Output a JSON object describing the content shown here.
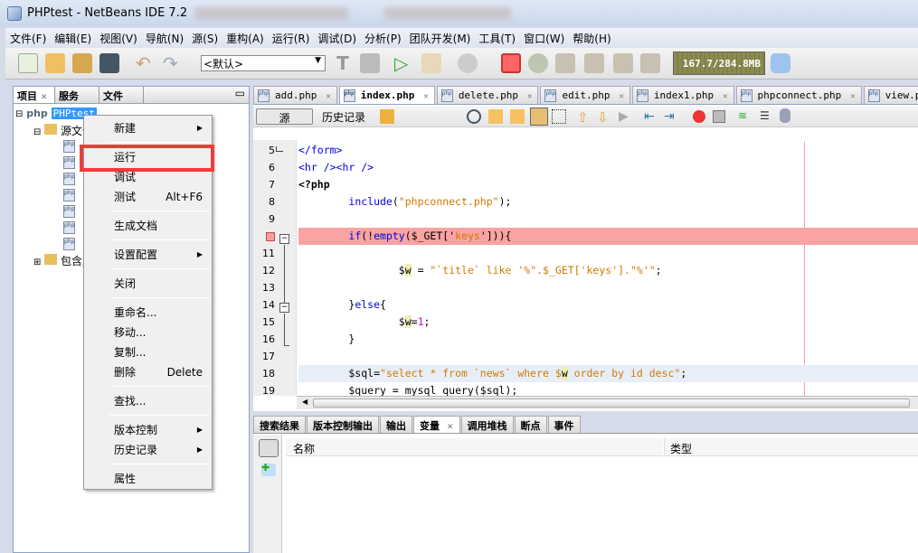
{
  "window": {
    "title": "PHPtest - NetBeans IDE 7.2"
  },
  "menu": [
    "文件(F)",
    "编辑(E)",
    "视图(V)",
    "导航(N)",
    "源(S)",
    "重构(A)",
    "运行(R)",
    "调试(D)",
    "分析(P)",
    "团队开发(M)",
    "工具(T)",
    "窗口(W)",
    "帮助(H)"
  ],
  "toolbar": {
    "config": "<默认>",
    "memory": "167.7/284.8MB"
  },
  "left_panel": {
    "tabs": [
      "项目",
      "服务",
      "文件"
    ],
    "project": "PHPtest",
    "project_icon": "php",
    "source_folder": "源文件",
    "include_folder": "包含路径",
    "file_count_icons": 7
  },
  "editor": {
    "tabs": [
      "add.php",
      "index.php",
      "delete.php",
      "edit.php",
      "index1.php",
      "phpconnect.php",
      "view.php"
    ],
    "active_tab": "index.php",
    "source_button": "源",
    "history_button": "历史记录",
    "lines": [
      {
        "n": "5",
        "seg": [
          [
            "</form>",
            "tag"
          ]
        ]
      },
      {
        "n": "6",
        "seg": [
          [
            "<hr /><hr />",
            "tag"
          ]
        ]
      },
      {
        "n": "7",
        "seg": [
          [
            "<?php",
            "php"
          ]
        ]
      },
      {
        "n": "8",
        "seg": [
          [
            "        ",
            ""
          ],
          [
            "include",
            "kw"
          ],
          [
            "(",
            ""
          ],
          [
            "\"phpconnect.php\"",
            "str"
          ],
          [
            ");",
            ""
          ]
        ]
      },
      {
        "n": "9",
        "seg": []
      },
      {
        "n": "",
        "bp": true,
        "seg": [
          [
            "        ",
            ""
          ],
          [
            "if",
            "kw"
          ],
          [
            "(!",
            ""
          ],
          [
            "empty",
            "kw"
          ],
          [
            "($_GET['",
            ""
          ],
          [
            "keys",
            "str"
          ],
          [
            "'])){",
            ""
          ]
        ]
      },
      {
        "n": "11",
        "seg": []
      },
      {
        "n": "12",
        "seg": [
          [
            "                $",
            ""
          ],
          [
            "w",
            "var"
          ],
          [
            " = ",
            ""
          ],
          [
            "\"`title` like '%\".$_GET['keys'].\"%'\"",
            "str"
          ],
          [
            ";",
            ""
          ]
        ]
      },
      {
        "n": "13",
        "seg": []
      },
      {
        "n": "14",
        "seg": [
          [
            "        }",
            ""
          ],
          [
            "else",
            "kw"
          ],
          [
            "{",
            ""
          ]
        ]
      },
      {
        "n": "15",
        "seg": [
          [
            "                $",
            ""
          ],
          [
            "w",
            "var"
          ],
          [
            "=",
            ""
          ],
          [
            "1",
            "num"
          ],
          [
            ";",
            ""
          ]
        ]
      },
      {
        "n": "16",
        "seg": [
          [
            "        }",
            ""
          ]
        ]
      },
      {
        "n": "17",
        "seg": []
      },
      {
        "n": "18",
        "cur": true,
        "seg": [
          [
            "        $sql=",
            ""
          ],
          [
            "\"select * from `news` where $",
            "str"
          ],
          [
            "w",
            "var"
          ],
          [
            " order by id desc\"",
            "str"
          ],
          [
            ";",
            ""
          ]
        ]
      },
      {
        "n": "19",
        "seg": [
          [
            "        $query = mysql_query($sql);",
            ""
          ]
        ]
      }
    ]
  },
  "bottom_panel": {
    "tabs": [
      "搜索结果",
      "版本控制输出",
      "输出",
      "变量",
      "调用堆栈",
      "断点",
      "事件"
    ],
    "active_tab": "变量",
    "columns": [
      "名称",
      "类型"
    ]
  },
  "context_menu": {
    "items": [
      {
        "label": "新建",
        "submenu": true
      },
      {
        "label": "运行",
        "highlighted_box": true
      },
      {
        "label": "调试"
      },
      {
        "label": "测试",
        "shortcut": "Alt+F6"
      },
      {
        "label": "生成文档"
      },
      {
        "label": "设置配置",
        "submenu": true
      },
      {
        "label": "关闭"
      },
      {
        "label": "重命名..."
      },
      {
        "label": "移动..."
      },
      {
        "label": "复制..."
      },
      {
        "label": "删除",
        "shortcut": "Delete"
      },
      {
        "label": "查找..."
      },
      {
        "label": "版本控制",
        "submenu": true
      },
      {
        "label": "历史记录",
        "submenu": true
      },
      {
        "label": "属性"
      }
    ]
  },
  "colors": {
    "breakpoint_line": "#f9a3a3",
    "annotation_box": "#f23a3a",
    "selection": "#3399ff"
  }
}
